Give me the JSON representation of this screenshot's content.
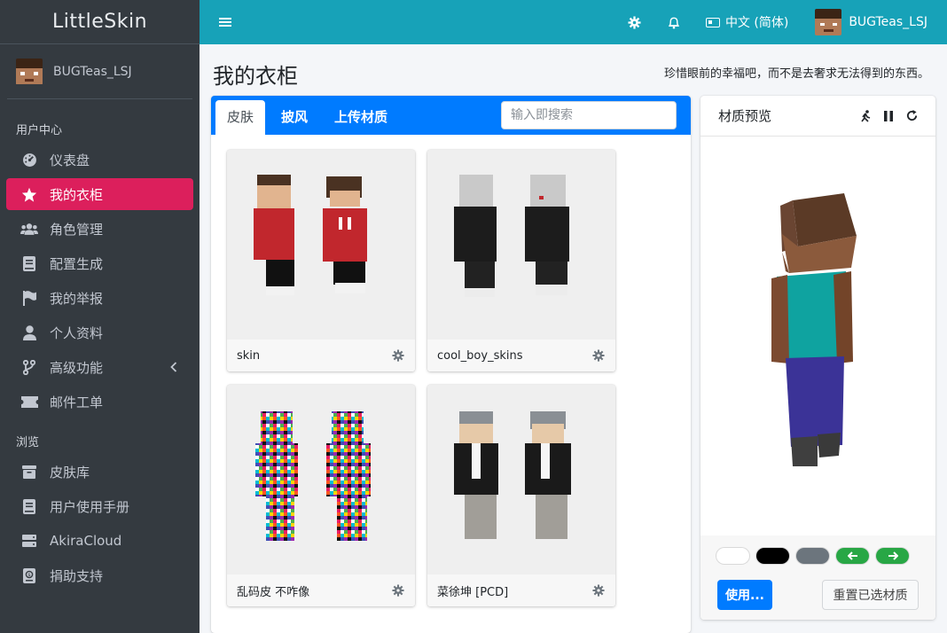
{
  "brand": "LittleSkin",
  "user": {
    "name": "BUGTeas_LSJ"
  },
  "sidebar": {
    "header_user_center": "用户中心",
    "header_browse": "浏览",
    "items": [
      {
        "label": "仪表盘",
        "icon": "dashboard-icon"
      },
      {
        "label": "我的衣柜",
        "icon": "star-icon",
        "active": true
      },
      {
        "label": "角色管理",
        "icon": "users-icon"
      },
      {
        "label": "配置生成",
        "icon": "book-icon"
      },
      {
        "label": "我的举报",
        "icon": "flag-icon"
      },
      {
        "label": "个人资料",
        "icon": "user-icon"
      },
      {
        "label": "高级功能",
        "icon": "branch-icon"
      },
      {
        "label": "邮件工单",
        "icon": "ticket-icon"
      },
      {
        "label": "皮肤库",
        "icon": "archive-icon"
      },
      {
        "label": "用户使用手册",
        "icon": "manual-icon"
      },
      {
        "label": "AkiraCloud",
        "icon": "server-icon"
      },
      {
        "label": "捐助支持",
        "icon": "donate-icon"
      }
    ]
  },
  "topbar": {
    "language": "中文 (简体)"
  },
  "page": {
    "title": "我的衣柜",
    "motto": "珍惜眼前的幸福吧，而不是去奢求无法得到的东西。"
  },
  "closet": {
    "tabs": [
      "皮肤",
      "披风",
      "上传材质"
    ],
    "search_placeholder": "输入即搜索",
    "items": [
      {
        "name": "skin"
      },
      {
        "name": "cool_boy_skins"
      },
      {
        "name": "乱码皮 不咋像"
      },
      {
        "name": "菜徐坤 [PCD]"
      }
    ]
  },
  "preview": {
    "title": "材质预览",
    "use_button": "使用...",
    "reset_button": "重置已选材质",
    "bg_colors": [
      "#ffffff",
      "#000000",
      "#6c757d"
    ],
    "accent": "#007bff"
  }
}
